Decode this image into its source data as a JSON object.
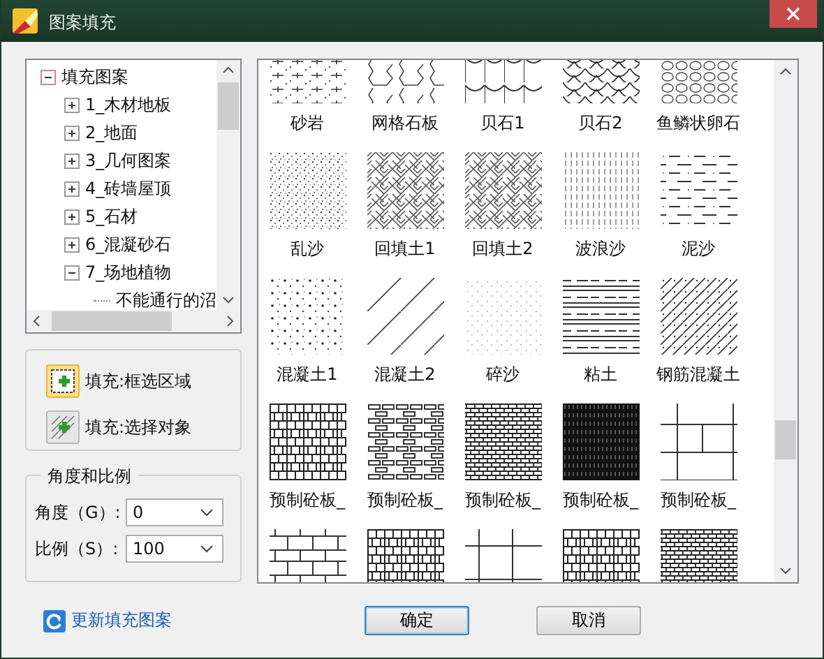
{
  "window": {
    "title": "图案填充"
  },
  "tree": {
    "label": "填充图案",
    "expanded": true,
    "children": [
      {
        "label": "1_木材地板",
        "expanded": false
      },
      {
        "label": "2_地面",
        "expanded": false
      },
      {
        "label": "3_几何图案",
        "expanded": false
      },
      {
        "label": "4_砖墙屋顶",
        "expanded": false
      },
      {
        "label": "5_石材",
        "expanded": false
      },
      {
        "label": "6_混凝砂石",
        "expanded": false
      },
      {
        "label": "7_场地植物",
        "expanded": true,
        "children": [
          {
            "label": "不能通行的沼"
          }
        ]
      }
    ]
  },
  "fill_buttons": [
    {
      "label": "填充:框选区域",
      "selected": true
    },
    {
      "label": "填充:选择对象",
      "selected": false
    }
  ],
  "angle_scale": {
    "title": "角度和比例",
    "fields": [
      {
        "label": "角度（G）:",
        "value": "0"
      },
      {
        "label": "比例（S）:",
        "value": "100"
      }
    ]
  },
  "patterns": [
    {
      "label": "砂岩",
      "kind": "dotgrid"
    },
    {
      "label": "网格石板",
      "kind": "hex"
    },
    {
      "label": "贝石1",
      "kind": "arcs"
    },
    {
      "label": "贝石2",
      "kind": "scales"
    },
    {
      "label": "鱼鳞状卵石",
      "kind": "smallscales"
    },
    {
      "label": "乱沙",
      "kind": "densedots"
    },
    {
      "label": "回填土1",
      "kind": "weave"
    },
    {
      "label": "回填土2",
      "kind": "weave"
    },
    {
      "label": "波浪沙",
      "kind": "vdash"
    },
    {
      "label": "泥沙",
      "kind": "dashes"
    },
    {
      "label": "混凝土1",
      "kind": "dots"
    },
    {
      "label": "混凝土2",
      "kind": "diagonal"
    },
    {
      "label": "碎沙",
      "kind": "finedots"
    },
    {
      "label": "粘土",
      "kind": "hlines"
    },
    {
      "label": "钢筋混凝土",
      "kind": "diagdots"
    },
    {
      "label": "预制砼板_",
      "kind": "basket"
    },
    {
      "label": "预制砼板_",
      "kind": "bricks"
    },
    {
      "label": "预制砼板_",
      "kind": "densebricks"
    },
    {
      "label": "预制砼板_",
      "kind": "dark"
    },
    {
      "label": "预制砼板_",
      "kind": "panel"
    },
    {
      "kind": "tiles"
    },
    {
      "kind": "basket"
    },
    {
      "kind": "cross"
    },
    {
      "kind": "basket"
    },
    {
      "kind": "densebricks"
    }
  ],
  "refresh_link": "更新填充图案",
  "buttons": [
    {
      "label": "确定",
      "default": true
    },
    {
      "label": "取消",
      "default": false
    }
  ]
}
